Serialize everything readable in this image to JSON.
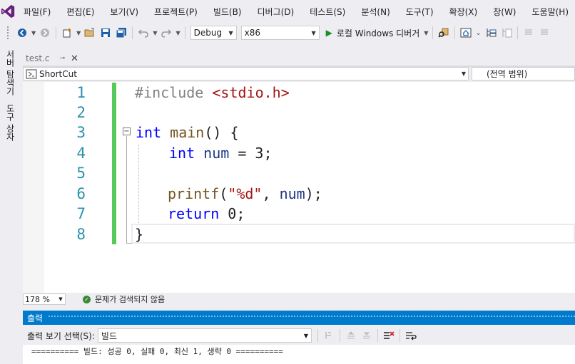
{
  "menu": {
    "items": [
      "파일(F)",
      "편집(E)",
      "보기(V)",
      "프로젝트(P)",
      "빌드(B)",
      "디버그(D)",
      "테스트(S)",
      "분석(N)",
      "도구(T)",
      "확장(X)",
      "창(W)",
      "도움말(H)"
    ]
  },
  "toolbar": {
    "configuration": "Debug",
    "platform": "x86",
    "run_label": "로컬 Windows 디버거"
  },
  "side_tabs": {
    "server_explorer": "서버 탐색기",
    "toolbox": "도구 상자"
  },
  "document_tab": {
    "filename": "test.c"
  },
  "navbar": {
    "scope": "ShortCut",
    "global": "(전역 범위)"
  },
  "editor": {
    "line_numbers": [
      "1",
      "2",
      "3",
      "4",
      "5",
      "6",
      "7",
      "8"
    ],
    "lines": {
      "l1_directive": "#include",
      "l1_header": "<stdio.h>",
      "l3_type": "int",
      "l3_name": "main",
      "l3_rest": "() {",
      "l4_type": "int",
      "l4_var": "num",
      "l4_rest": " = 3;",
      "l6_fn": "printf",
      "l6_open": "(",
      "l6_str": "\"%d\"",
      "l6_comma": ", ",
      "l6_var": "num",
      "l6_close": ");",
      "l7_kw": "return",
      "l7_rest": " 0;",
      "l8": "}"
    }
  },
  "status": {
    "zoom": "178 %",
    "issues": "문제가 검색되지 않음"
  },
  "output": {
    "title": "출력",
    "source_label": "출력 보기 선택(S):",
    "source_value": "빌드",
    "text": "========== 빌드: 성공 0, 실패 0, 최신 1, 생략 0 =========="
  },
  "colors": {
    "accent": "#007acc",
    "change_bar": "#57c85a",
    "line_number": "#2b91af",
    "keyword": "#0000ff",
    "string": "#a31515"
  }
}
